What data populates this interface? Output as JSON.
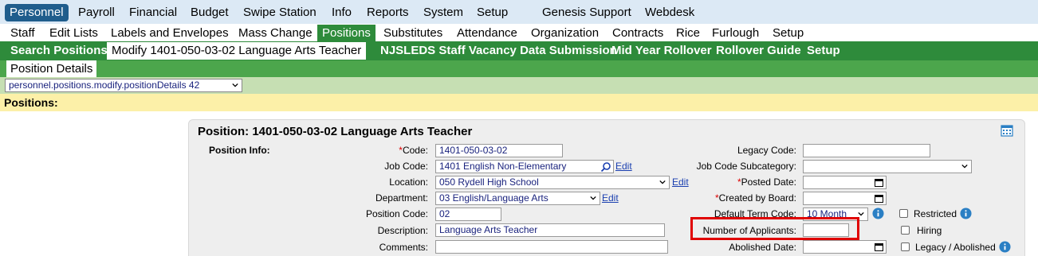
{
  "topnav": {
    "items": [
      "Personnel",
      "Payroll",
      "Financial",
      "Budget",
      "Swipe Station",
      "Info",
      "Reports",
      "System",
      "Setup",
      "Genesis Support",
      "Webdesk"
    ],
    "active": "Personnel"
  },
  "subnav1": {
    "items": [
      "Staff",
      "Edit Lists",
      "Labels and Envelopes",
      "Mass Change",
      "Positions",
      "Substitutes",
      "Attendance",
      "Organization",
      "Contracts",
      "Rice",
      "Furlough",
      "Setup"
    ],
    "active": "Positions"
  },
  "subnav2": {
    "items": [
      "Search Positions",
      "Modify 1401-050-03-02 Language Arts Teacher",
      "NJSLEDS Staff Vacancy Data Submission",
      "Mid Year Rollover",
      "Rollover Guide",
      "Setup"
    ],
    "active": "Modify 1401-050-03-02 Language Arts Teacher"
  },
  "subnav3": {
    "tab": "Position Details"
  },
  "screen_select": {
    "value": "personnel.positions.modify.positionDetails 42"
  },
  "positions_label": "Positions:",
  "panel": {
    "title": "Position: 1401-050-03-02 Language Arts Teacher",
    "section_label": "Position Info:",
    "fields": {
      "code": {
        "label": "Code:",
        "value": "1401-050-03-02",
        "required": "*"
      },
      "job_code": {
        "label": "Job Code:",
        "value": "1401 English Non-Elementary",
        "edit": "Edit"
      },
      "location": {
        "label": "Location:",
        "value": "050 Rydell High School",
        "edit": "Edit"
      },
      "department": {
        "label": "Department:",
        "value": "03 English/Language Arts",
        "edit": "Edit"
      },
      "position_code": {
        "label": "Position Code:",
        "value": "02"
      },
      "description": {
        "label": "Description:",
        "value": "Language Arts Teacher"
      },
      "comments": {
        "label": "Comments:",
        "value": ""
      },
      "legacy_code": {
        "label": "Legacy Code:",
        "value": ""
      },
      "job_code_subcategory": {
        "label": "Job Code Subcategory:",
        "value": ""
      },
      "posted_date": {
        "label": "Posted Date:",
        "value": "",
        "required": "*"
      },
      "created_by_board": {
        "label": "Created by Board:",
        "value": "",
        "required": "*"
      },
      "default_term_code": {
        "label": "Default Term Code:",
        "value": "10 Month"
      },
      "number_of_applicants": {
        "label": "Number of Applicants:",
        "value": ""
      },
      "abolished_date": {
        "label": "Abolished Date:",
        "value": ""
      }
    },
    "checkboxes": {
      "restricted": "Restricted",
      "hiring": "Hiring",
      "legacy_abolished": "Legacy / Abolished"
    }
  },
  "colors": {
    "topnav_bg": "#dce9f5",
    "active_top": "#1f5d8c",
    "green_bar": "#2e8b3b",
    "highlight": "#e00000"
  }
}
